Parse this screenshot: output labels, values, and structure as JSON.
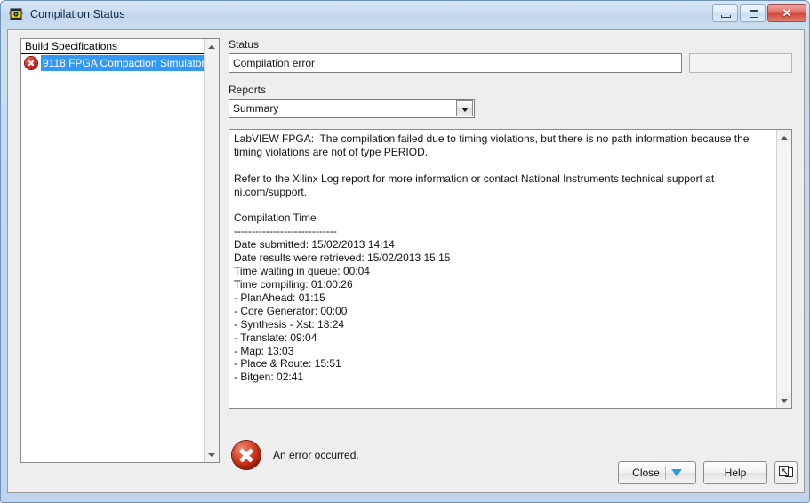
{
  "window": {
    "title": "Compilation Status",
    "app_icon": "labview-vi-icon",
    "controls": {
      "minimize": "minimize-button",
      "maximize": "maximize-button",
      "close": "close-button",
      "close_glyph": "✕"
    },
    "colors": {
      "titlebar": "#cbddf1",
      "frame_border": "#6f92b8",
      "client_bg": "#eeeeee",
      "selection_blue": "#3399f5",
      "error_red": "#d4241a",
      "caret_blue": "#2e9be0"
    }
  },
  "build_specifications": {
    "header": "Build Specifications",
    "items": [
      {
        "label": "9118 FPGA Compaction Simulator",
        "status_icon": "error-icon",
        "selected": true
      }
    ],
    "scrollbar": {
      "up_arrow": "scroll-up-arrow",
      "down_arrow": "scroll-down-arrow"
    }
  },
  "status": {
    "label": "Status",
    "value": "Compilation error",
    "secondary_value": ""
  },
  "reports": {
    "label": "Reports",
    "selected": "Summary",
    "options": [
      "Summary"
    ],
    "dropdown_icon": "chevron-down-icon"
  },
  "report_body": {
    "text": "LabVIEW FPGA:  The compilation failed due to timing violations, but there is no path information because the timing violations are not of type PERIOD.\n\nRefer to the Xilinx Log report for more information or contact National Instruments technical support at ni.com/support.\n\nCompilation Time\n-----------------------------\nDate submitted: 15/02/2013 14:14\nDate results were retrieved: 15/02/2013 15:15\nTime waiting in queue: 00:04\nTime compiling: 01:00:26\n- PlanAhead: 01:15\n- Core Generator: 00:00\n- Synthesis - Xst: 18:24\n- Translate: 09:04\n- Map: 13:03\n- Place & Route: 15:51\n- Bitgen: 02:41",
    "scrollbar": {
      "up_arrow": "scroll-up-arrow",
      "down_arrow": "scroll-down-arrow"
    }
  },
  "notice": {
    "icon": "error-icon",
    "text": "An error occurred."
  },
  "buttons": {
    "close": "Close",
    "close_dropdown_icon": "caret-down-icon",
    "help": "Help",
    "resize": "resize-window-icon"
  }
}
